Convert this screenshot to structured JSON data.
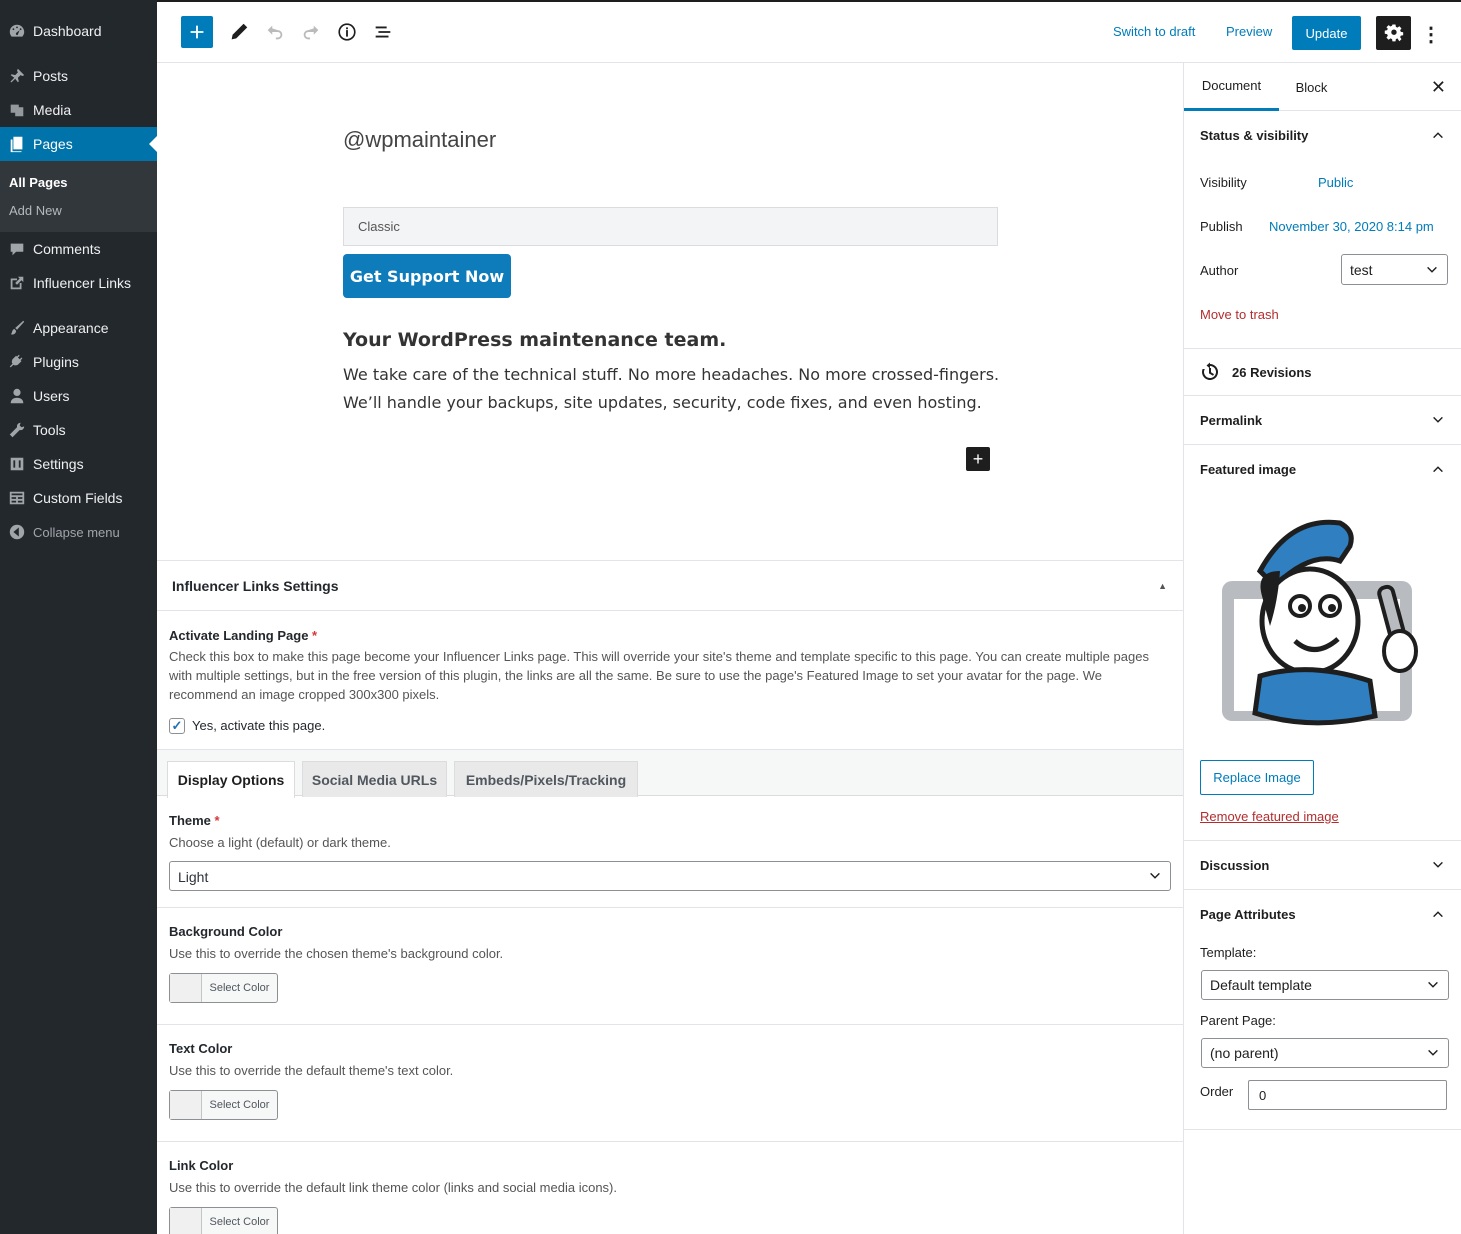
{
  "admin_menu": {
    "items": [
      {
        "label": "Dashboard",
        "icon": "dashboard-icon"
      },
      {
        "label": "Posts",
        "icon": "pin-icon"
      },
      {
        "label": "Media",
        "icon": "media-icon"
      },
      {
        "label": "Pages",
        "icon": "pages-icon",
        "active": true
      },
      {
        "label": "Comments",
        "icon": "comment-icon"
      },
      {
        "label": "Influencer Links",
        "icon": "external-link-icon"
      },
      {
        "label": "Appearance",
        "icon": "brush-icon"
      },
      {
        "label": "Plugins",
        "icon": "plug-icon"
      },
      {
        "label": "Users",
        "icon": "user-icon"
      },
      {
        "label": "Tools",
        "icon": "wrench-icon"
      },
      {
        "label": "Settings",
        "icon": "sliders-icon"
      },
      {
        "label": "Custom Fields",
        "icon": "table-icon"
      }
    ],
    "submenu": {
      "all_pages": "All Pages",
      "add_new": "Add New"
    },
    "collapse": "Collapse menu"
  },
  "toolbar": {
    "switch_draft": "Switch to draft",
    "preview": "Preview",
    "update": "Update"
  },
  "editor": {
    "title": "@wpmaintainer",
    "classic_label": "Classic",
    "support_button": "Get Support Now",
    "heading": "Your WordPress maintenance team.",
    "paragraph": "We take care of the technical stuff. No more headaches. No more crossed-fingers. We’ll handle your backups, site updates, security, code fixes, and even hosting."
  },
  "metabox": {
    "title": "Influencer Links Settings",
    "activate_label": "Activate Landing Page",
    "activate_desc": "Check this box to make this page become your Influencer Links page. This will override your site's theme and template specific to this page. You can create multiple pages with multiple settings, but in the free version of this plugin, the links are all the same. Be sure to use the page's Featured Image to set your avatar for the page. We recommend an image cropped 300x300 pixels.",
    "checkbox_label": "Yes, activate this page.",
    "checkbox_checked": true,
    "tabs": [
      "Display Options",
      "Social Media URLs",
      "Embeds/Pixels/Tracking"
    ],
    "theme_label": "Theme",
    "theme_desc": "Choose a light (default) or dark theme.",
    "theme_value": "Light",
    "bg_label": "Background Color",
    "bg_desc": "Use this to override the chosen theme's background color.",
    "text_label": "Text Color",
    "text_desc": "Use this to override the default theme's text color.",
    "link_label": "Link Color",
    "link_desc": "Use this to override the default link theme color (links and social media icons).",
    "select_color": "Select Color"
  },
  "sidebar": {
    "tab_document": "Document",
    "tab_block": "Block",
    "status_title": "Status & visibility",
    "visibility_label": "Visibility",
    "visibility_value": "Public",
    "publish_label": "Publish",
    "publish_value": "November 30, 2020 8:14 pm",
    "author_label": "Author",
    "author_value": "test",
    "trash": "Move to trash",
    "revisions": "26 Revisions",
    "permalink": "Permalink",
    "featured_title": "Featured image",
    "replace_image": "Replace Image",
    "remove_image": "Remove featured image",
    "discussion": "Discussion",
    "page_attributes": "Page Attributes",
    "template_label": "Template:",
    "template_value": "Default template",
    "parent_label": "Parent Page:",
    "parent_value": "(no parent)",
    "order_label": "Order",
    "order_value": "0"
  },
  "colors": {
    "accent": "#007cba",
    "admin_bg": "#23282d",
    "danger": "#b32d2e"
  }
}
